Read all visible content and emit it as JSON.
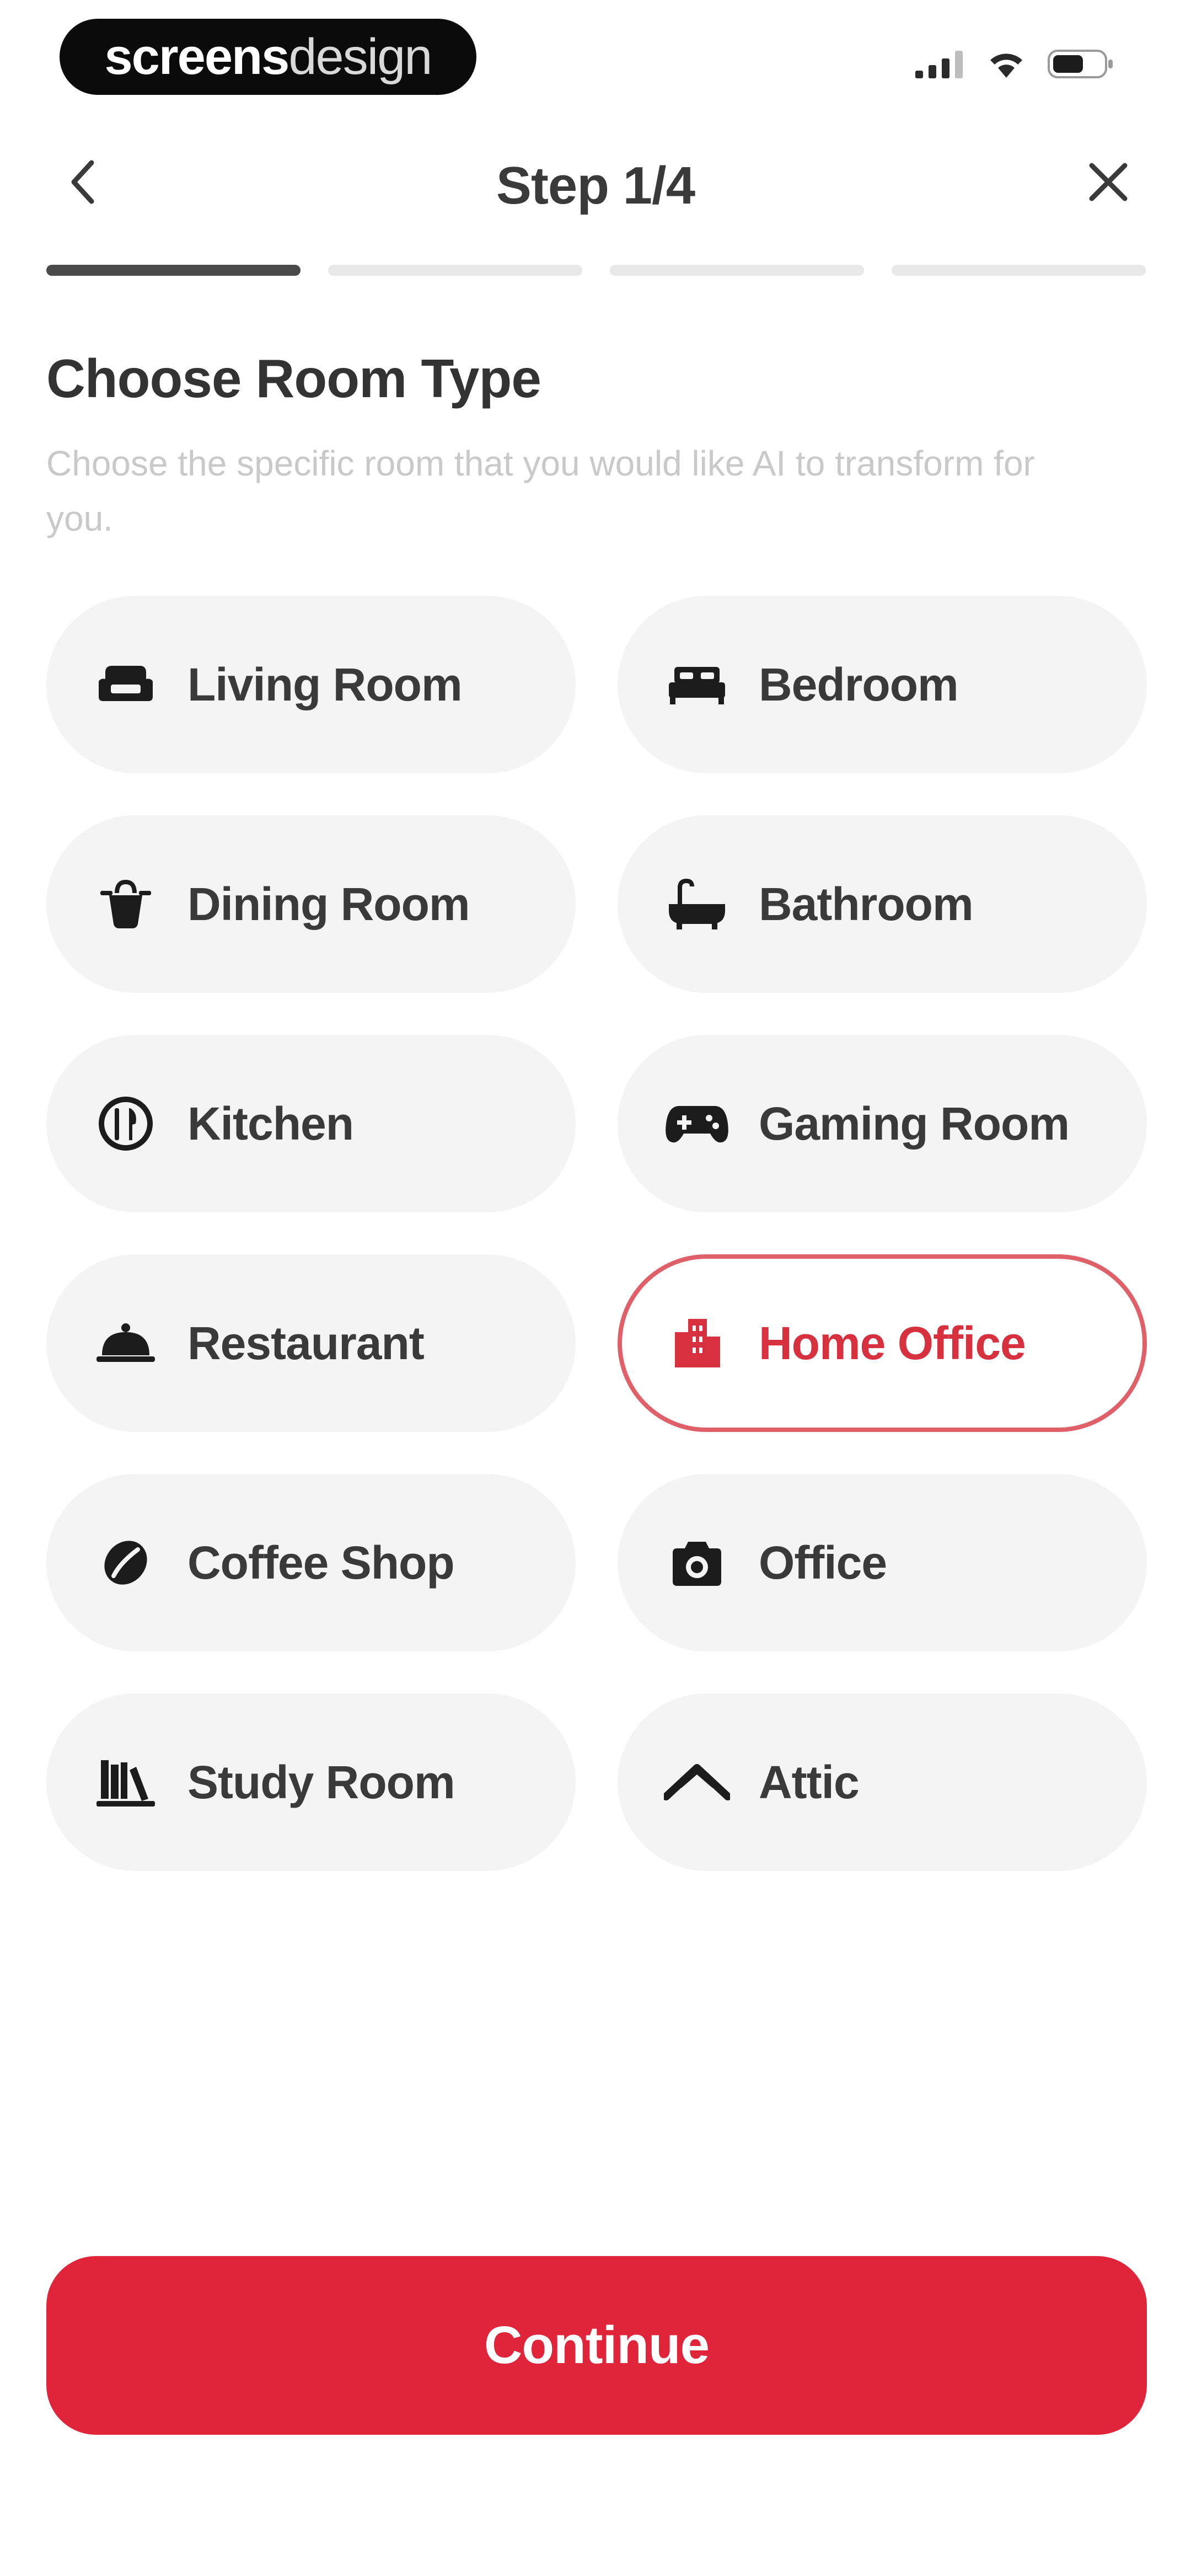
{
  "brand": {
    "bold": "screens",
    "light": "design"
  },
  "header": {
    "title": "Step 1/4"
  },
  "progress": {
    "total_steps": 4,
    "current_step": 1
  },
  "content": {
    "title": "Choose Room Type",
    "subtitle": "Choose the specific room that you would like AI to transform for you."
  },
  "rooms": [
    {
      "label": "Living Room",
      "icon": "sofa-icon",
      "selected": false
    },
    {
      "label": "Bedroom",
      "icon": "bed-icon",
      "selected": false
    },
    {
      "label": "Dining Room",
      "icon": "dining-icon",
      "selected": false
    },
    {
      "label": "Bathroom",
      "icon": "bathtub-icon",
      "selected": false
    },
    {
      "label": "Kitchen",
      "icon": "kitchen-icon",
      "selected": false
    },
    {
      "label": "Gaming Room",
      "icon": "gamepad-icon",
      "selected": false
    },
    {
      "label": "Restaurant",
      "icon": "cloche-icon",
      "selected": false
    },
    {
      "label": "Home Office",
      "icon": "building-icon",
      "selected": true
    },
    {
      "label": "Coffee Shop",
      "icon": "coffee-bean-icon",
      "selected": false
    },
    {
      "label": "Office",
      "icon": "camera-icon",
      "selected": false
    },
    {
      "label": "Study Room",
      "icon": "books-icon",
      "selected": false
    },
    {
      "label": "Attic",
      "icon": "roof-icon",
      "selected": false
    }
  ],
  "actions": {
    "continue_label": "Continue"
  },
  "colors": {
    "accent": "#e0243a",
    "selected_text": "#d7303f",
    "tile_bg": "#f4f4f4"
  }
}
